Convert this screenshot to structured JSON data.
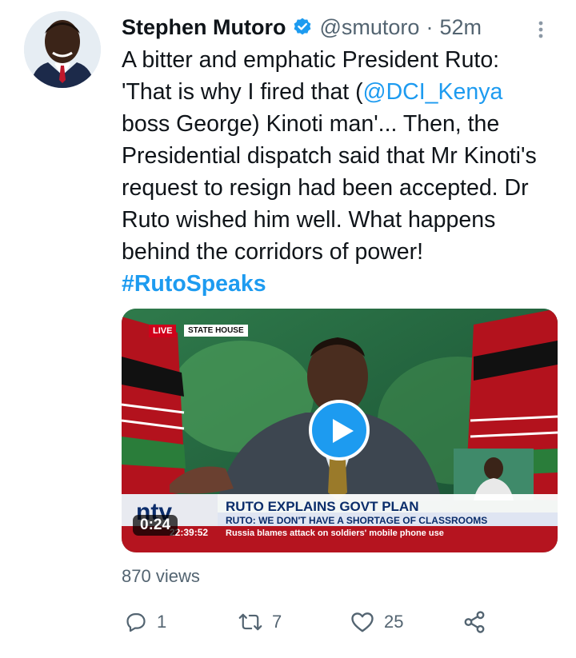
{
  "author": {
    "name": "Stephen Mutoro",
    "handle": "@smutoro",
    "separator": "·",
    "time": "52m",
    "verified_icon": "verified-badge-icon"
  },
  "tweet": {
    "text_parts": {
      "p1": "A bitter and emphatic President Ruto: 'That is why I fired that (",
      "mention": "@DCI_Kenya",
      "p2": " boss George) Kinoti man'... Then, the Presidential dispatch said that Mr Kinoti's request to resign had been accepted. Dr Ruto wished him well. What happens behind the corridors of power! ",
      "hashtag": "#RutoSpeaks"
    }
  },
  "media": {
    "duration": "0:24",
    "live_label": "LIVE",
    "location_label": "STATE HOUSE",
    "headline": "RUTO EXPLAINS GOVT PLAN",
    "subheadline": "RUTO: WE DON'T HAVE A SHORTAGE OF CLASSROOMS",
    "ticker_time": "22:39:52",
    "ticker_text": "Russia blames attack on soldiers' mobile phone use",
    "channel_logo": "ntv"
  },
  "stats": {
    "views": "870 views",
    "replies": "1",
    "retweets": "7",
    "likes": "25"
  },
  "colors": {
    "accent": "#1d9bf0",
    "text": "#0f1419",
    "muted": "#536471"
  }
}
